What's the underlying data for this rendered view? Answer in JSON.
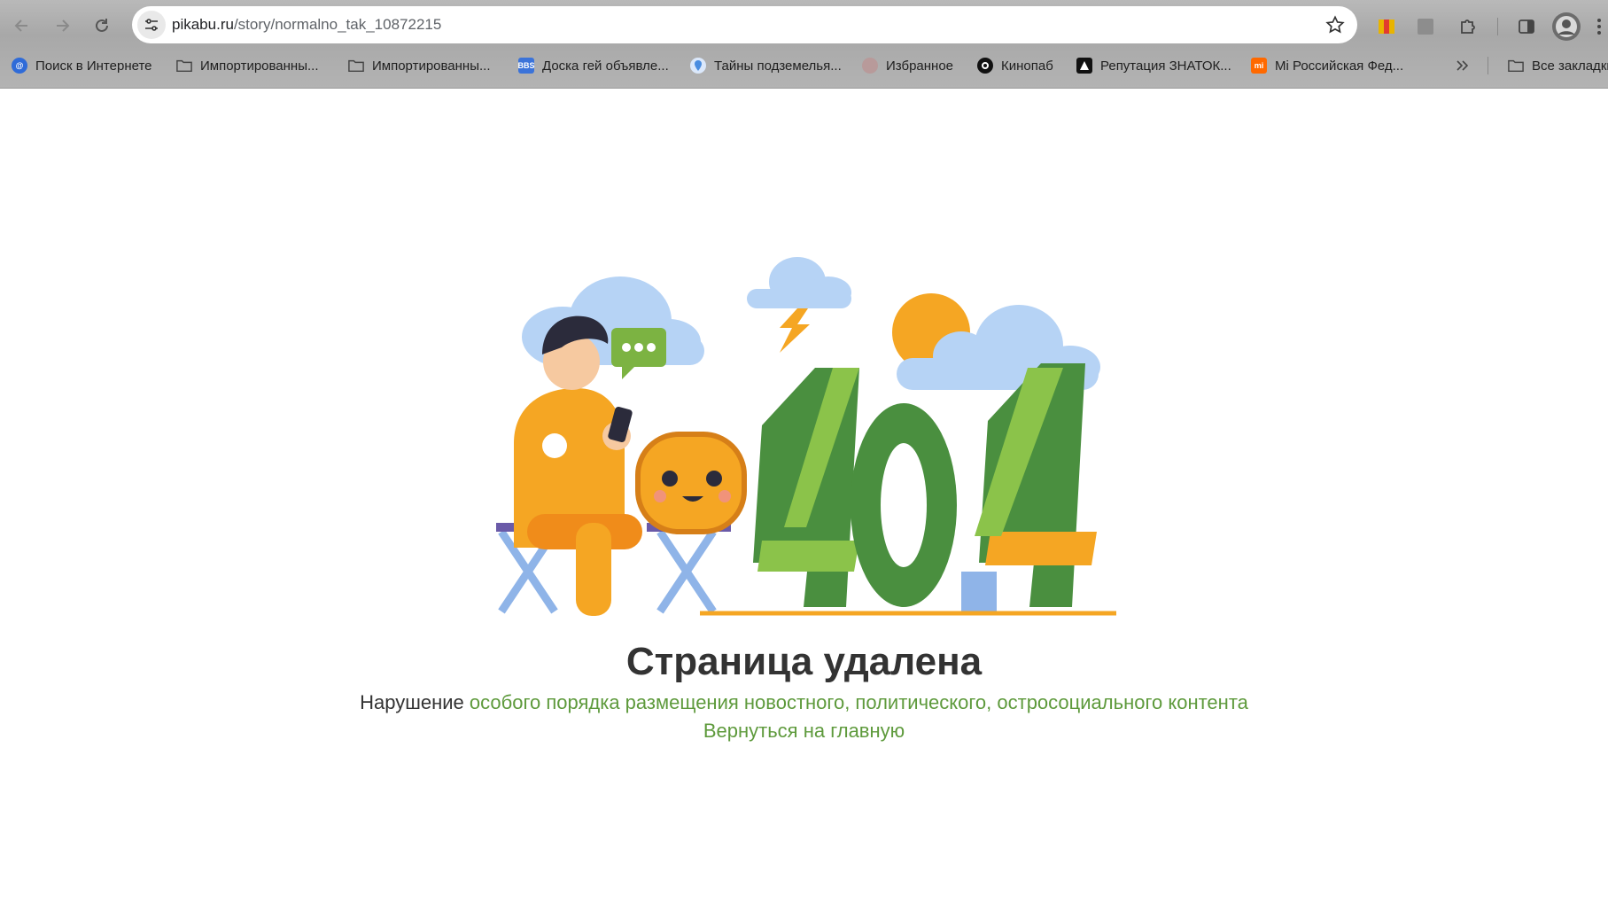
{
  "browser": {
    "url_host": "pikabu.ru",
    "url_path": "/story/normalno_tak_10872215"
  },
  "bookmarks": [
    {
      "label": "Поиск в Интернете",
      "icon": "at-sign-icon",
      "color": "#2f6bd8"
    },
    {
      "label": "Импортированны...",
      "icon": "folder-icon"
    },
    {
      "label": "Импортированны...",
      "icon": "folder-icon"
    },
    {
      "label": "Доска гей объявле...",
      "icon": "bbs-icon",
      "icon_text": "BBS",
      "color": "#3b73d9"
    },
    {
      "label": "Тайны подземелья...",
      "icon": "pin-icon",
      "color": "#4a8de0"
    },
    {
      "label": "Избранное",
      "icon": "avatar-icon"
    },
    {
      "label": "Кинопаб",
      "icon": "kinopub-icon"
    },
    {
      "label": "Репутация ЗНАТОК...",
      "icon": "znatok-icon"
    },
    {
      "label": "Mi Российская Фед...",
      "icon": "mi-icon",
      "icon_text": "mi",
      "color": "#ff6900"
    }
  ],
  "all_bookmarks_label": "Все закладки",
  "page": {
    "title": "Страница удалена",
    "reason_prefix": "Нарушение",
    "reason_link": "особого порядка размещения новостного, политического, остросоциального контента",
    "back_link": "Вернуться на главную"
  },
  "colors": {
    "link_green": "#5e9a3c",
    "number_green": "#4a8f3f",
    "light_green": "#8bc34a",
    "orange": "#f5a623",
    "cloud_blue": "#b6d3f5"
  }
}
